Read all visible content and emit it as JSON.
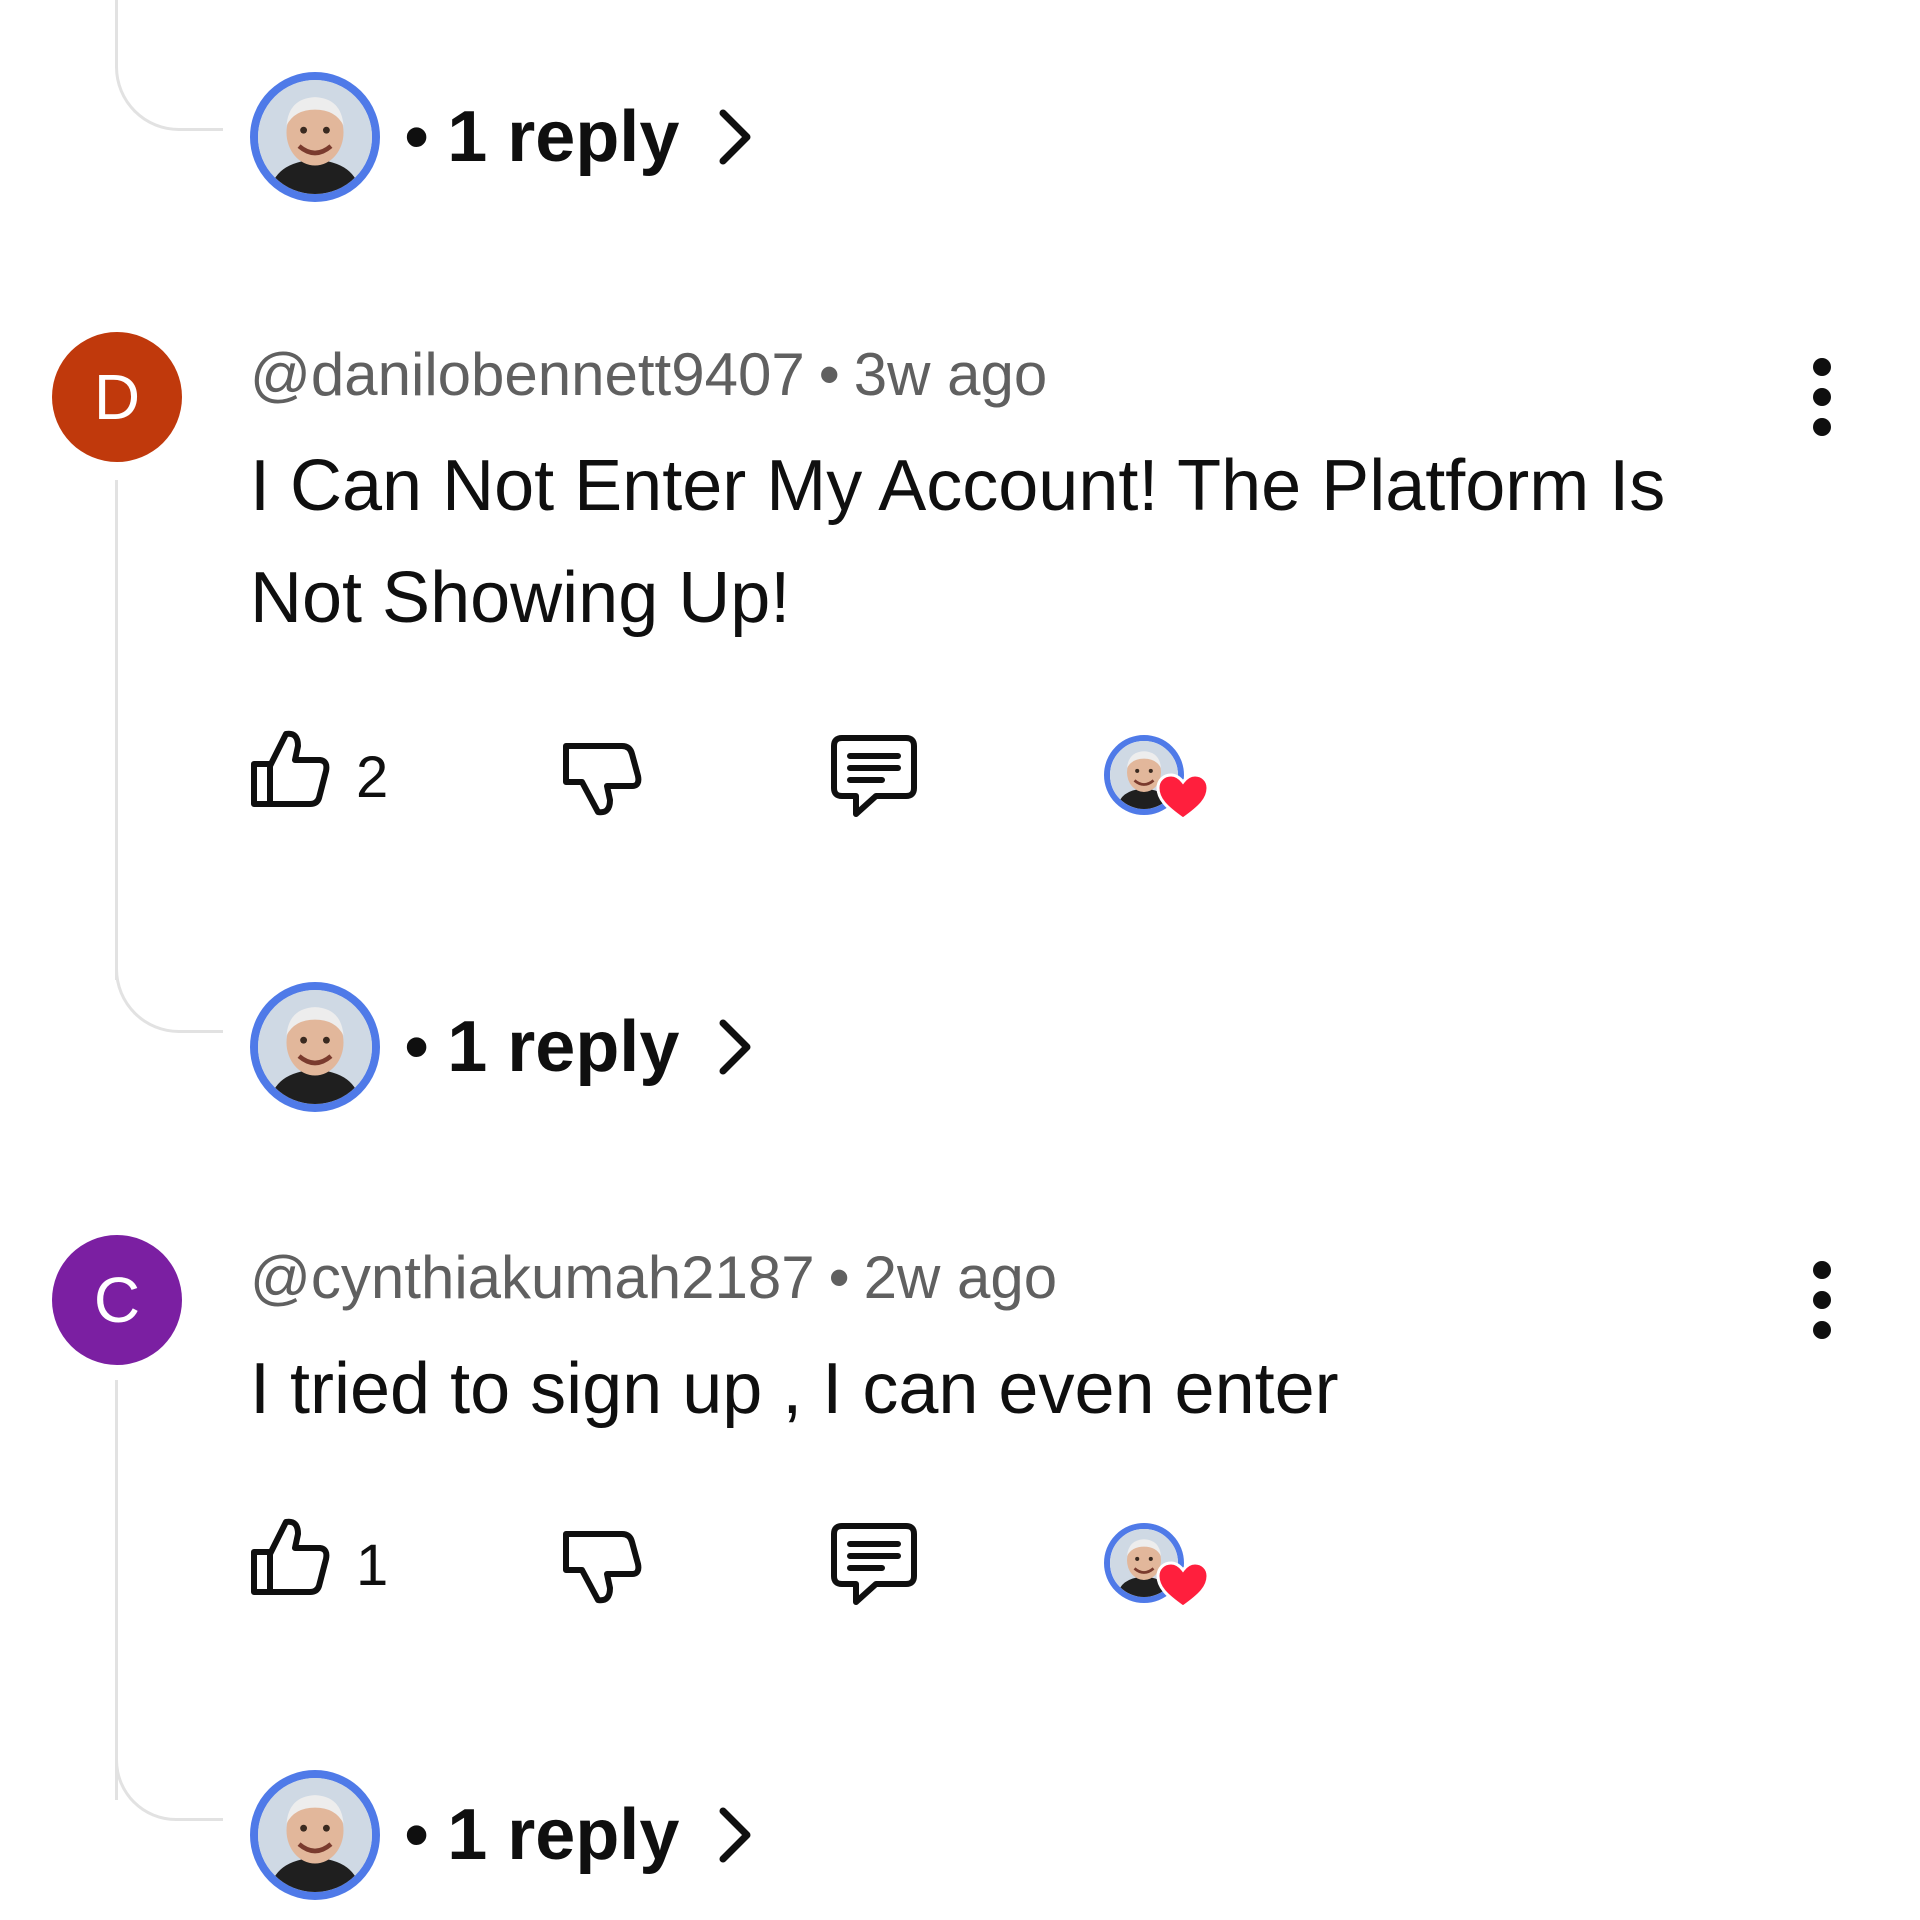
{
  "colors": {
    "avatar_d": "#c0390c",
    "avatar_c": "#7b1fa2",
    "reply_ring": "#4f7ae8",
    "heart": "#ff1f3d",
    "thread_line": "#e2e2e2"
  },
  "top_reply": {
    "bullet": "•",
    "label": "1 reply",
    "avatar_icon": "creator-avatar"
  },
  "comments": [
    {
      "avatar_letter": "D",
      "handle": "@danilobennett9407",
      "separator": "•",
      "time": "3w ago",
      "text": "I Can Not Enter My Account! The Platform Is Not Showing Up!",
      "likes": "2",
      "reply_bullet": "•",
      "reply_label": "1 reply"
    },
    {
      "avatar_letter": "C",
      "handle": "@cynthiakumah2187",
      "separator": "•",
      "time": "2w ago",
      "text": "I tried to sign up , I can even enter",
      "likes": "1",
      "reply_bullet": "•",
      "reply_label": "1 reply"
    }
  ]
}
